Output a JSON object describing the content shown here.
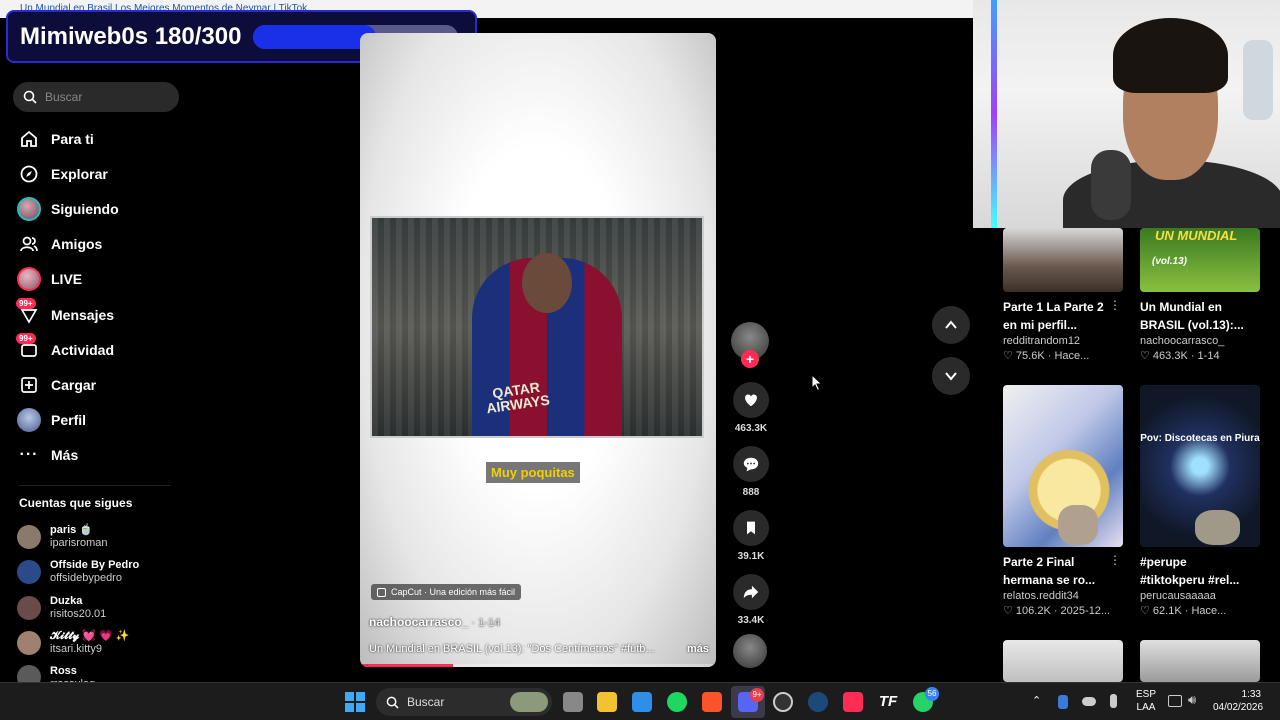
{
  "browser": {
    "tab_title": "Un Mundial en Brasil Los Mejores Momentos de Neymar | TikTok"
  },
  "overlay": {
    "label": "Mimiweb0s 180/300",
    "progress": 0.6
  },
  "search": {
    "placeholder": "Buscar"
  },
  "nav": [
    {
      "label": "Para ti",
      "icon": "home-icon"
    },
    {
      "label": "Explorar",
      "icon": "compass-icon"
    },
    {
      "label": "Siguiendo",
      "icon": "following-avatar-icon"
    },
    {
      "label": "Amigos",
      "icon": "friends-icon"
    },
    {
      "label": "LIVE",
      "icon": "live-avatar-icon"
    },
    {
      "label": "Mensajes",
      "icon": "messages-icon",
      "badge": "99+"
    },
    {
      "label": "Actividad",
      "icon": "activity-icon",
      "badge": "99+"
    },
    {
      "label": "Cargar",
      "icon": "upload-icon"
    },
    {
      "label": "Perfil",
      "icon": "profile-icon"
    },
    {
      "label": "Más",
      "icon": "more-icon"
    }
  ],
  "following": {
    "title": "Cuentas que sigues",
    "accounts": [
      {
        "name": "paris 🍵",
        "user": "iparisroman",
        "color": "#8a7a6a"
      },
      {
        "name": "Offside By Pedro",
        "user": "offsidebypedro",
        "color": "#2a4a8a"
      },
      {
        "name": "Duzka",
        "user": "risitos20.01",
        "color": "#6a4a4a"
      },
      {
        "name": "𝓚𝓲𝓽𝓽𝔂 💓 💗 ✨",
        "user": "itsari.kitty9",
        "color": "#a08070"
      },
      {
        "name": "Ross",
        "user": "rrossulog",
        "color": "#5a5a5a"
      }
    ]
  },
  "video": {
    "caption": "Muy poquitas",
    "sponsor": "QATAR AIRWAYS",
    "capcut": "CapCut · Una edición más fácil",
    "author": "nachoocarrasco_",
    "date": " · 1-14",
    "description": "Un Mundial en BRASIL (vol.13): \"Dos Centímetros\" #fútb...",
    "more": "más",
    "progress": 0.26
  },
  "actions": {
    "likes": "463.3K",
    "comments": "888",
    "saves": "39.1K",
    "shares": "33.4K"
  },
  "recommended": [
    {
      "title1": "Parte 1 La Parte 2",
      "title2": "en mi perfil...",
      "user": "redditrandom12",
      "meta": "♡ 75.6K · Hace...",
      "thumb_text": ""
    },
    {
      "title1": "Un Mundial en",
      "title2": "BRASIL (vol.13):...",
      "user": "nachoocarrasco_",
      "meta": "♡ 463.3K · 1-14",
      "thumb_text": "UN MUNDIAL",
      "thumb_sub": "(vol.13)"
    },
    {
      "title1": "Parte 2 Final",
      "title2": "hermana se ro...",
      "user": "relatos.reddit34",
      "meta": "♡ 106.2K · 2025-12...",
      "thumb_text": ""
    },
    {
      "title1": "#perupe",
      "title2": "#tiktokperu #rel...",
      "user": "perucausaaaaa",
      "meta": "♡ 62.1K · Hace...",
      "thumb_text": "Pov: Discotecas en Piura"
    }
  ],
  "taskbar": {
    "search": "Buscar",
    "lang1": "ESP",
    "lang2": "LAA",
    "time": "1:33",
    "date": "04/02/2026",
    "discord_badge": "9+",
    "whatsapp_badge": "56"
  },
  "colors": {
    "accent": "#fe2c55",
    "overlay_fill": "#1a2fe8"
  }
}
